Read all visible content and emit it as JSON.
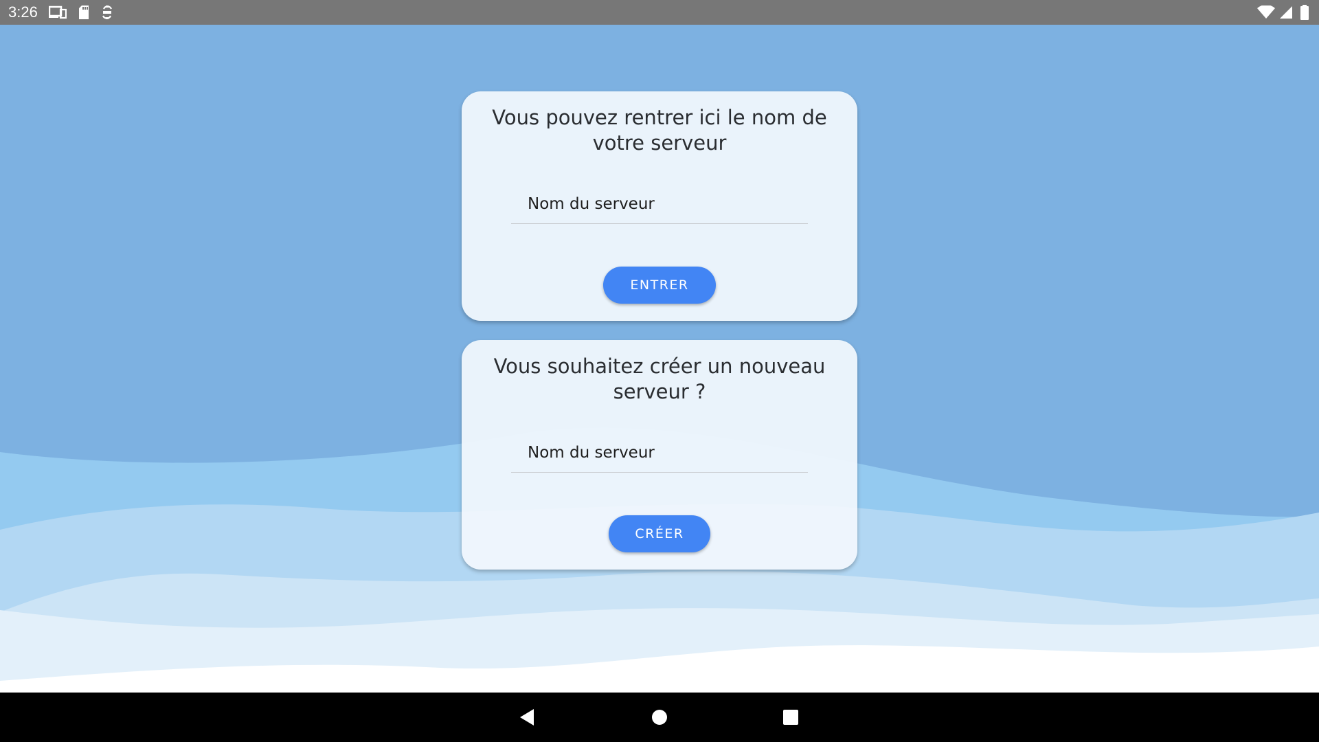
{
  "status_bar": {
    "time": "3:26",
    "left_icons": [
      "devices-icon",
      "sd-card-icon",
      "sync-icon"
    ],
    "right_icons": [
      "wifi-icon",
      "cellular-signal-icon",
      "battery-icon"
    ]
  },
  "join_card": {
    "title": "Vous pouvez rentrer ici le nom de votre serveur",
    "field_placeholder": "Nom du serveur",
    "button_label": "ENTRER"
  },
  "create_card": {
    "title": "Vous souhaitez créer un nouveau serveur ?",
    "field_placeholder": "Nom du serveur",
    "button_label": "CRÉER"
  },
  "nav_bar": {
    "buttons": [
      "back-icon",
      "home-icon",
      "recents-icon"
    ]
  },
  "colors": {
    "background": "#7db1e1",
    "accent_button": "#4285f4",
    "status_bar": "#777777",
    "nav_bar": "#000000"
  }
}
